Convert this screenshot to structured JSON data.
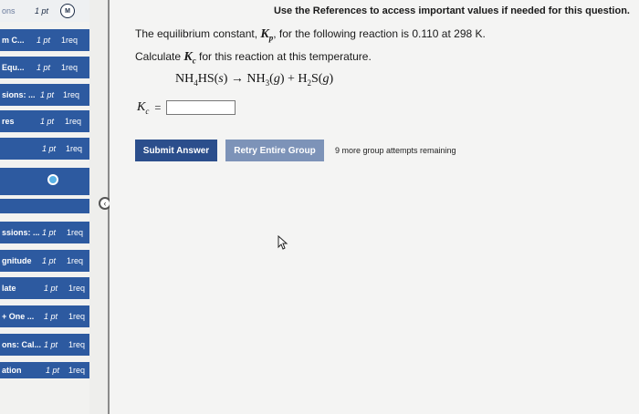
{
  "sidebar": {
    "items": [
      {
        "label": "ons",
        "points": "1 pt",
        "status": "M"
      },
      {
        "label": "m C...",
        "points": "1 pt",
        "status": "1req"
      },
      {
        "label": "Equ...",
        "points": "1 pt",
        "status": "1req"
      },
      {
        "label": "sions: ...",
        "points": "1 pt",
        "status": "1req"
      },
      {
        "label": "res",
        "points": "1 pt",
        "status": "1req"
      },
      {
        "label": "",
        "points": "1 pt",
        "status": "1req"
      },
      {
        "label": "ssions: ...",
        "points": "1 pt",
        "status": "1req"
      },
      {
        "label": "gnitude",
        "points": "1 pt",
        "status": "1req"
      },
      {
        "label": "late",
        "points": "1 pt",
        "status": "1req"
      },
      {
        "label": "+ One ...",
        "points": "1 pt",
        "status": "1req"
      },
      {
        "label": "ons: Cal...",
        "points": "1 pt",
        "status": "1req"
      },
      {
        "label": "ation",
        "points": "1 pt",
        "status": "1req"
      }
    ]
  },
  "question": {
    "references_note": "Use the References to access important values if needed for this question.",
    "line1_pre": "The equilibrium constant, ",
    "line1_sym": "K",
    "line1_sub": "p",
    "line1_post": ", for the following reaction is 0.110 at 298 K.",
    "line2_pre": "Calculate ",
    "line2_sym": "K",
    "line2_sub": "c",
    "line2_post": " for this reaction at this temperature.",
    "reaction": {
      "r1": "NH",
      "r1_sub": "4",
      "r2": "HS(",
      "r2_state": "s",
      "r2_close": ")",
      "arrow": " → ",
      "p1": "NH",
      "p1_sub": "3",
      "p1_open": "(",
      "p1_state": "g",
      "p1_close": ") + H",
      "p2_sub": "2",
      "p2": "S(",
      "p2_state": "g",
      "p2_close": ")"
    },
    "answer_label": "K",
    "answer_sub": "c",
    "answer_eq": "=",
    "answer_value": ""
  },
  "buttons": {
    "submit": "Submit Answer",
    "retry": "Retry Entire Group"
  },
  "attempts_text": "9 more group attempts remaining",
  "colors": {
    "sidebar_active": "#2d5aa0",
    "submit_bg": "#2b4e8c",
    "retry_bg": "#7d93b8"
  }
}
